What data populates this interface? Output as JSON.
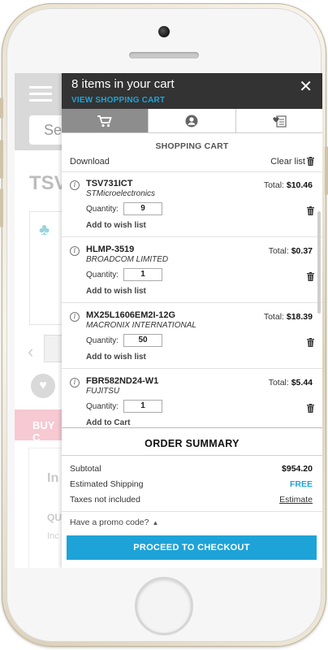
{
  "background_page": {
    "search_text": "Se",
    "title_text": "TSV",
    "buy_button": "BUY C",
    "section_heading": "In",
    "qty_label": "QU",
    "inc_text": "Inc"
  },
  "cart": {
    "title": "8 items in your cart",
    "view_cart_link": "VIEW SHOPPING CART",
    "tabs": [
      {
        "icon": "cart-icon",
        "active": true
      },
      {
        "icon": "user-icon",
        "active": false
      },
      {
        "icon": "wishlist-icon",
        "active": false
      }
    ],
    "section_heading": "SHOPPING CART",
    "download_label": "Download",
    "clear_list_label": "Clear list",
    "quantity_label": "Quantity:",
    "total_label": "Total:",
    "items": [
      {
        "part": "TSV731ICT",
        "manufacturer": "STMicroelectronics",
        "total": "$10.46",
        "quantity": "9",
        "link": "Add to wish list"
      },
      {
        "part": "HLMP-3519",
        "manufacturer": "BROADCOM LIMITED",
        "total": "$0.37",
        "quantity": "1",
        "link": "Add to wish list"
      },
      {
        "part": "MX25L1606EM2I-12G",
        "manufacturer": "MACRONIX INTERNATIONAL",
        "total": "$18.39",
        "quantity": "50",
        "link": "Add to wish list"
      },
      {
        "part": "FBR582ND24-W1",
        "manufacturer": "FUJITSU",
        "total": "$5.44",
        "quantity": "1",
        "link": "Add to Cart"
      }
    ]
  },
  "summary": {
    "title": "ORDER SUMMARY",
    "subtotal_label": "Subtotal",
    "subtotal_value": "$954.20",
    "shipping_label": "Estimated Shipping",
    "shipping_value": "FREE",
    "taxes_label": "Taxes not included",
    "taxes_value": "Estimate",
    "promo_label": "Have a promo code?",
    "checkout_label": "PROCEED TO CHECKOUT"
  },
  "colors": {
    "accent": "#1ea3d8",
    "header_bg": "#333333",
    "active_tab": "#8d8d8d"
  }
}
